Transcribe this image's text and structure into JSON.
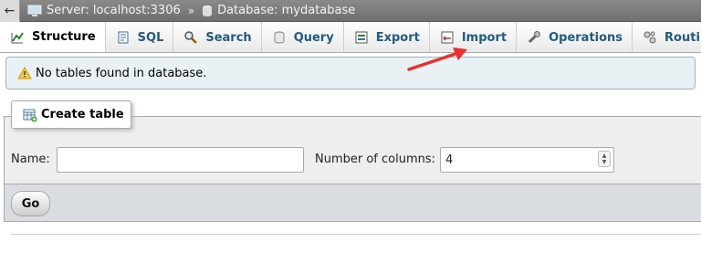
{
  "breadcrumb": {
    "server": "Server: localhost:3306",
    "separator": "»",
    "database": "Database: mydatabase"
  },
  "tabs": [
    {
      "label": "Structure",
      "icon": "structure-icon",
      "active": true
    },
    {
      "label": "SQL",
      "icon": "sql-icon"
    },
    {
      "label": "Search",
      "icon": "search-icon"
    },
    {
      "label": "Query",
      "icon": "query-icon"
    },
    {
      "label": "Export",
      "icon": "export-icon"
    },
    {
      "label": "Import",
      "icon": "import-icon"
    },
    {
      "label": "Operations",
      "icon": "operations-icon"
    },
    {
      "label": "Routi",
      "icon": "routines-icon"
    }
  ],
  "notice": {
    "text": "No tables found in database."
  },
  "create_table": {
    "title": "Create table",
    "name_label": "Name:",
    "name_value": "",
    "columns_label": "Number of columns:",
    "columns_value": "4",
    "go_label": "Go"
  },
  "colors": {
    "tab_text": "#235a81",
    "notice_bg": "#e9f1f5",
    "annotation_arrow": "#e8312f"
  }
}
